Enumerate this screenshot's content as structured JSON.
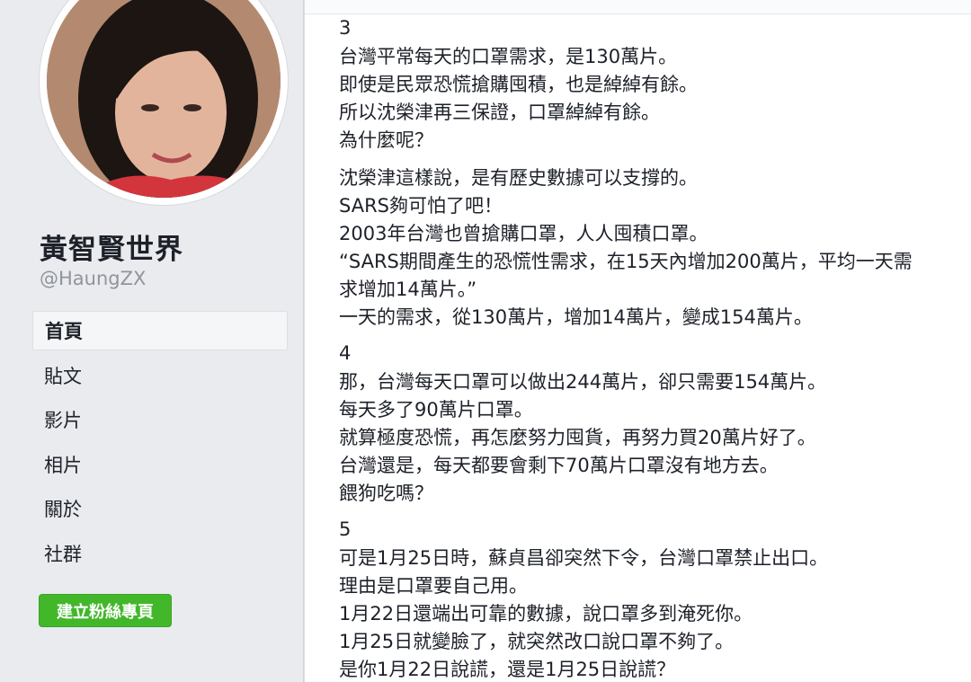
{
  "sidebar": {
    "page_name": "黃智賢世界",
    "handle": "@HaungZX",
    "nav": [
      {
        "label": "首頁",
        "active": true
      },
      {
        "label": "貼文",
        "active": false
      },
      {
        "label": "影片",
        "active": false
      },
      {
        "label": "相片",
        "active": false
      },
      {
        "label": "關於",
        "active": false
      },
      {
        "label": "社群",
        "active": false
      }
    ],
    "create_page_button": "建立粉絲專頁"
  },
  "post": {
    "sections": [
      {
        "number": "3",
        "lines": [
          "台灣平常每天的口罩需求，是130萬片。",
          "即使是民眾恐慌搶購囤積，也是綽綽有餘。",
          "所以沈榮津再三保證，口罩綽綽有餘。",
          "為什麼呢？"
        ]
      },
      {
        "number": "",
        "lines": [
          "沈榮津這樣說，是有歷史數據可以支撐的。",
          "SARS夠可怕了吧！",
          "2003年台灣也曾搶購口罩，人人囤積口罩。",
          "“SARS期間產生的恐慌性需求，在15天內增加200萬片，平均一天需",
          "求增加14萬片。”",
          "一天的需求，從130萬片，增加14萬片，變成154萬片。"
        ]
      },
      {
        "number": "4",
        "lines": [
          "那，台灣每天口罩可以做出244萬片，卻只需要154萬片。",
          "每天多了90萬片口罩。",
          "就算極度恐慌，再怎麼努力囤貨，再努力買20萬片好了。",
          "台灣還是，每天都要會剩下70萬片口罩沒有地方去。",
          "餵狗吃嗎？"
        ]
      },
      {
        "number": "5",
        "lines": [
          "可是1月25日時，蘇貞昌卻突然下令，台灣口罩禁止出口。",
          "理由是口罩要自己用。",
          "1月22日還端出可靠的數據，說口罩多到淹死你。",
          "1月25日就變臉了，就突然改口說口罩不夠了。",
          "是你1月22日說謊，還是1月25日說謊？"
        ]
      }
    ]
  },
  "colors": {
    "sidebar_bg": "#e9ebee",
    "text": "#1d2129",
    "muted": "#90949c",
    "button_green": "#42b72a"
  }
}
